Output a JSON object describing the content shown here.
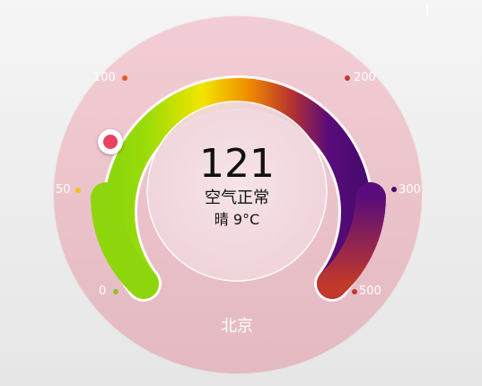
{
  "gauge": {
    "aqi_value": "121",
    "status": "空气正常",
    "weather": "晴  9°C",
    "city": "北京",
    "scale_labels": [
      "0",
      "50",
      "100",
      "200",
      "300",
      "500"
    ],
    "marker_colors": [
      "#8fbf2a",
      "#f4c21c",
      "#e05a2b",
      "#c0392b",
      "#4a1070",
      "#c0392b"
    ],
    "arc_colors": [
      "#8ed60c",
      "#f2e400",
      "#f08a00",
      "#b8342e",
      "#5a0c7a",
      "#6d1060",
      "#c0392b"
    ],
    "thumb_color": "#e84261"
  }
}
